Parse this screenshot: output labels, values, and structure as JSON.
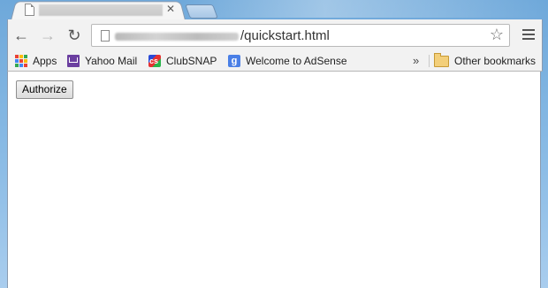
{
  "browser": {
    "address_bar": {
      "url_visible_text": "/quickstart.html"
    },
    "controls": {
      "back_icon": "arrow-left-icon",
      "forward_icon": "arrow-right-icon",
      "reload_icon": "reload-icon",
      "star_icon": "star-icon",
      "menu_icon": "hamburger-menu-icon"
    },
    "bookmarks": {
      "items": [
        {
          "label": "Apps",
          "icon": "apps-grid-icon"
        },
        {
          "label": "Yahoo Mail",
          "icon": "mail-envelope-icon"
        },
        {
          "label": "ClubSNAP",
          "icon": "clubsnap-icon"
        },
        {
          "label": "Welcome to AdSense",
          "icon": "google-icon"
        }
      ],
      "overflow_label": "»",
      "other_bookmarks": {
        "label": "Other bookmarks",
        "icon": "folder-icon"
      }
    }
  },
  "page": {
    "authorize_button_label": "Authorize"
  }
}
